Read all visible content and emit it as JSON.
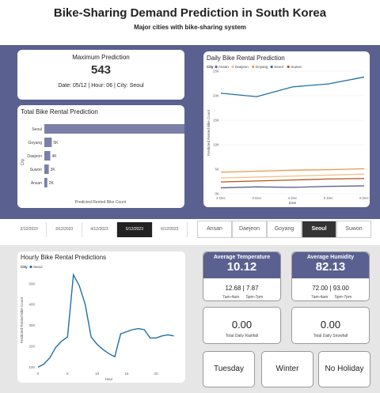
{
  "header": {
    "title": "Bike-Sharing Demand Prediction in South Korea",
    "subtitle": "Major cities with bike-sharing system"
  },
  "max_card": {
    "title": "Maximum Prediction",
    "value": "543",
    "detail": "Date: 05/12 | Hour: 06 | City: Seoul"
  },
  "total_chart": {
    "title": "Total Bike Rental Prediction",
    "ylabel": "City",
    "xlabel": "Predicted Rented Bike Count"
  },
  "daily_chart": {
    "title": "Daily Bike Rental Prediction",
    "legend_title": "City",
    "ylabel": "Predicted Rented Bike Count",
    "xlabel": "Date"
  },
  "hourly_chart": {
    "title": "Hourly Bike Rental Predictions",
    "legend_title": "City",
    "ylabel": "Predicted Rented Bike Count",
    "xlabel": "Hour"
  },
  "date_tabs": [
    "2/12/2023",
    "3/12/2023",
    "4/12/2023",
    "5/12/2023",
    "6/12/2023"
  ],
  "date_selected": 3,
  "city_tabs": [
    "Ansan",
    "Daejeon",
    "Goyang",
    "Seoul",
    "Suwon"
  ],
  "city_selected": 3,
  "temperature": {
    "title": "Average Temperature",
    "value": "10.12",
    "range": "12.68 | 7.87",
    "sub1": "7am-4am",
    "sub2": "5pm-7pm"
  },
  "humidity": {
    "title": "Average Humidity",
    "value": "82.13",
    "range": "72.00 | 93.00",
    "sub1": "7am-4am",
    "sub2": "5pm-7pm"
  },
  "rainfall": {
    "value": "0.00",
    "label": "Total Daily Rainfall"
  },
  "snowfall": {
    "value": "0.00",
    "label": "Total Daily Snowfall"
  },
  "day_card": {
    "label": "Tuesday"
  },
  "season_card": {
    "label": "Winter"
  },
  "holiday_card": {
    "label": "No Holiday"
  },
  "colors": {
    "panel": "#5a6190",
    "seoul": "#1f6fa8",
    "ansan": "#5a6190",
    "daejeon": "#f2c18d",
    "goyang": "#e79a4e",
    "suwon": "#b5531a",
    "bar": "#7a80a8"
  },
  "chart_data": [
    {
      "type": "bar",
      "orientation": "horizontal",
      "title": "Total Bike Rental Prediction",
      "xlabel": "Predicted Rented Bike Count",
      "ylabel": "City",
      "categories": [
        "Seoul",
        "Goyang",
        "Daejeon",
        "Suwon",
        "Ansan"
      ],
      "values": [
        99,
        5,
        4,
        3,
        2
      ],
      "labels": [
        "99K",
        "5K",
        "4K",
        "3K",
        "2K"
      ]
    },
    {
      "type": "line",
      "title": "Daily Bike Rental Prediction",
      "xlabel": "Date",
      "ylabel": "Predicted Rented Bike Count",
      "x": [
        "2 Dec",
        "3 Dec",
        "4 Dec",
        "5 Dec",
        "6 Dec"
      ],
      "yticks": [
        "0K",
        "5K",
        "10K",
        "15K",
        "20K",
        "25K"
      ],
      "ylim": [
        0,
        25
      ],
      "series": [
        {
          "name": "Ansan",
          "color": "#5a6190",
          "values": [
            1.2,
            1.4,
            1.3,
            1.5,
            1.6
          ]
        },
        {
          "name": "Daejeon",
          "color": "#f2c18d",
          "values": [
            3.2,
            3.4,
            3.6,
            3.8,
            4.0
          ]
        },
        {
          "name": "Goyang",
          "color": "#e79a4e",
          "values": [
            4.4,
            4.6,
            4.8,
            4.9,
            5.1
          ]
        },
        {
          "name": "Seoul",
          "color": "#1f6fa8",
          "values": [
            20.5,
            19.8,
            21.8,
            22.4,
            23.8
          ]
        },
        {
          "name": "Suwon",
          "color": "#b5531a",
          "values": [
            2.4,
            2.6,
            2.8,
            3.0,
            3.1
          ]
        }
      ]
    },
    {
      "type": "line",
      "title": "Hourly Bike Rental Predictions",
      "xlabel": "Hour",
      "ylabel": "Predicted Rented Bike Count",
      "xticks": [
        0,
        5,
        10,
        15,
        20
      ],
      "yticks": [
        100,
        200,
        300,
        400,
        500
      ],
      "xlim": [
        0,
        24
      ],
      "ylim": [
        90,
        560
      ],
      "series": [
        {
          "name": "Seoul",
          "color": "#1f6fa8",
          "x": [
            0,
            1,
            2,
            3,
            4,
            5,
            6,
            7,
            8,
            9,
            10,
            11,
            12,
            13,
            14,
            15,
            16,
            17,
            18,
            19,
            20,
            21,
            22,
            23
          ],
          "values": [
            100,
            115,
            145,
            195,
            225,
            245,
            543,
            490,
            400,
            245,
            210,
            185,
            165,
            150,
            260,
            270,
            280,
            285,
            280,
            240,
            240,
            250,
            255,
            250
          ]
        }
      ]
    }
  ]
}
